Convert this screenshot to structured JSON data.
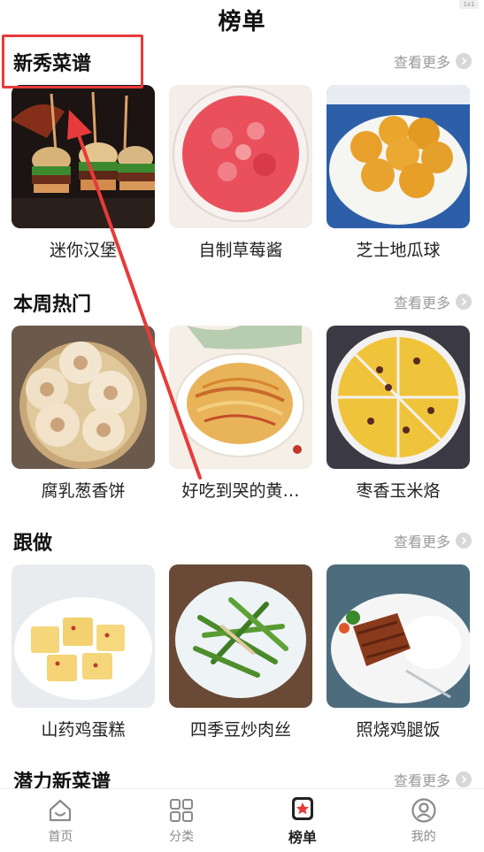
{
  "header": {
    "title": "榜单",
    "corner": "1x1"
  },
  "more_label": "查看更多",
  "sections": [
    {
      "title": "新秀菜谱",
      "items": [
        {
          "name": "迷你汉堡",
          "icon": "burger-photo"
        },
        {
          "name": "自制草莓酱",
          "icon": "jam-photo"
        },
        {
          "name": "芝士地瓜球",
          "icon": "sweet-potato-balls-photo"
        }
      ]
    },
    {
      "title": "本周热门",
      "items": [
        {
          "name": "腐乳葱香饼",
          "icon": "scallion-pancake-photo"
        },
        {
          "name": "好吃到哭的黄…",
          "icon": "noodles-photo"
        },
        {
          "name": "枣香玉米烙",
          "icon": "corn-pancake-photo"
        }
      ]
    },
    {
      "title": "跟做",
      "items": [
        {
          "name": "山药鸡蛋糕",
          "icon": "yam-cake-photo"
        },
        {
          "name": "四季豆炒肉丝",
          "icon": "green-beans-photo"
        },
        {
          "name": "照烧鸡腿饭",
          "icon": "teriyaki-chicken-rice-photo"
        }
      ]
    },
    {
      "title": "潜力新菜谱"
    }
  ],
  "tabbar": [
    {
      "label": "首页",
      "icon": "home-icon"
    },
    {
      "label": "分类",
      "icon": "grid-icon"
    },
    {
      "label": "榜单",
      "icon": "ranking-icon",
      "active": true
    },
    {
      "label": "我的",
      "icon": "user-icon"
    }
  ],
  "annotation": {
    "color": "#e83a3a"
  }
}
